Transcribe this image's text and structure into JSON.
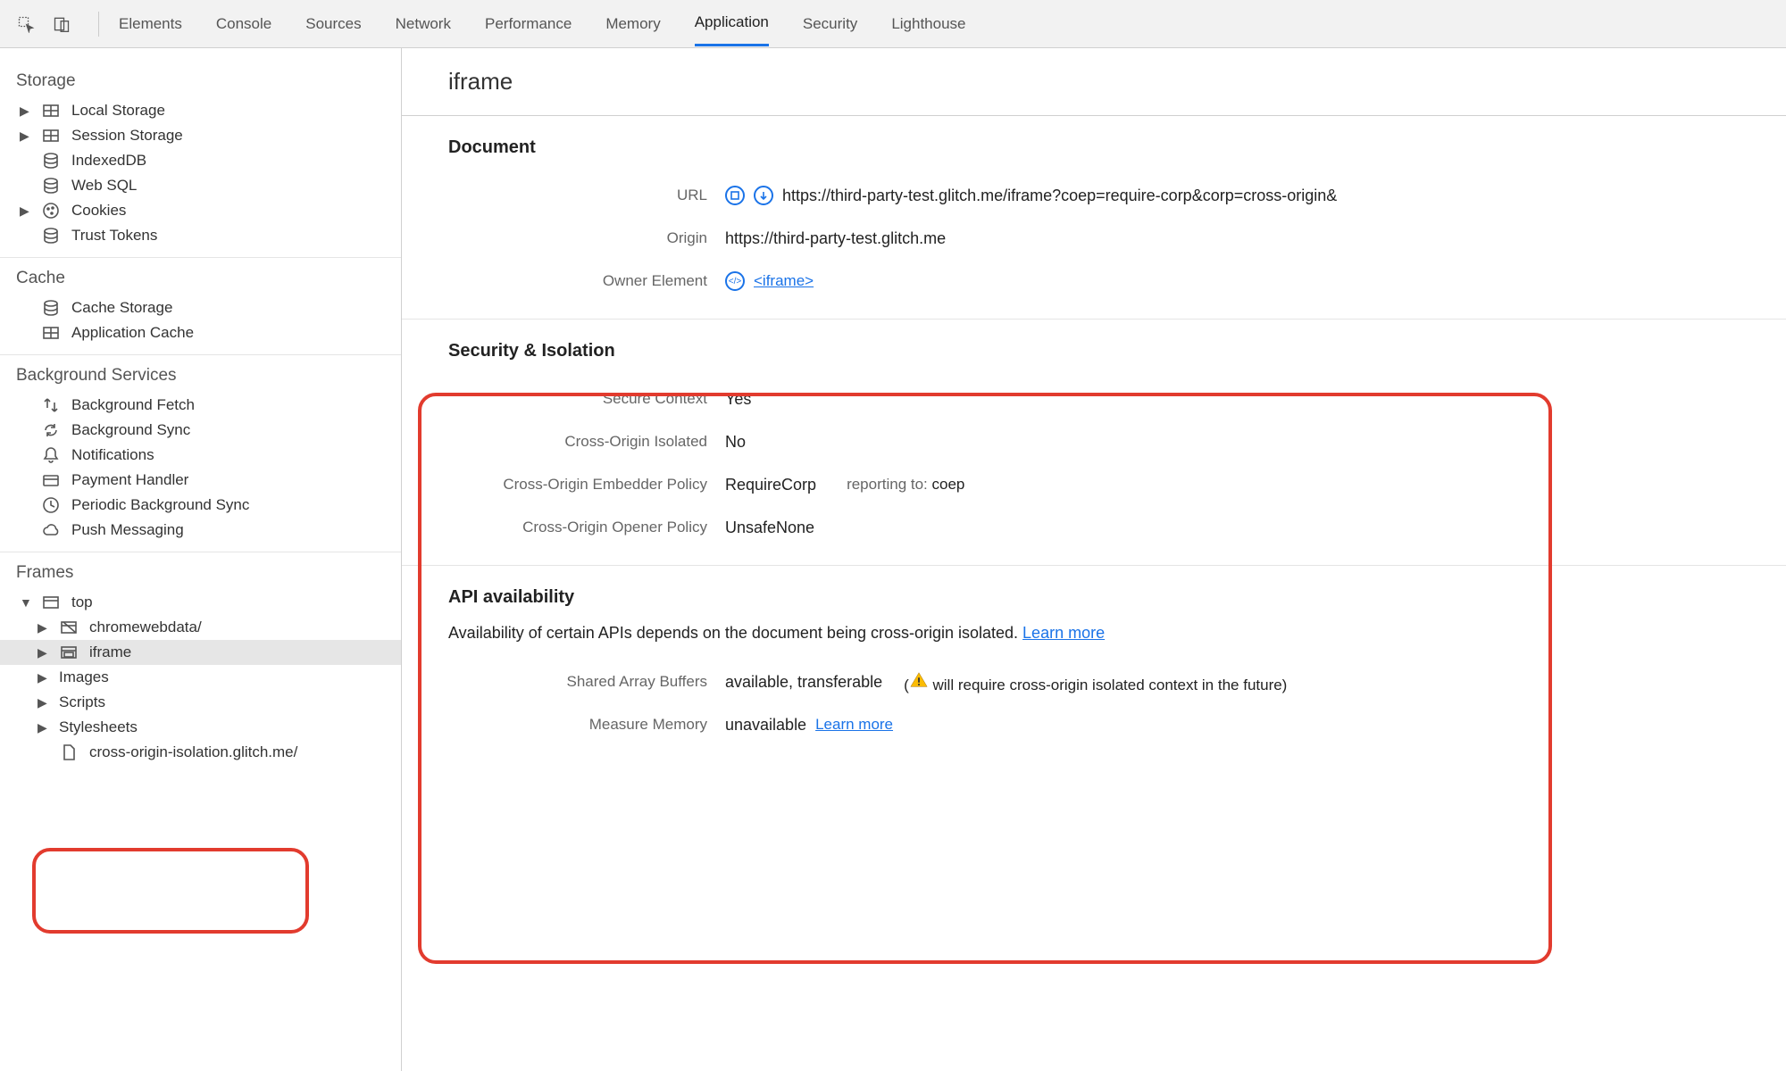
{
  "tabs": [
    "Elements",
    "Console",
    "Sources",
    "Network",
    "Performance",
    "Memory",
    "Application",
    "Security",
    "Lighthouse"
  ],
  "active_tab": "Application",
  "sidebar": {
    "storage": {
      "header": "Storage",
      "items": [
        "Local Storage",
        "Session Storage",
        "IndexedDB",
        "Web SQL",
        "Cookies",
        "Trust Tokens"
      ]
    },
    "cache": {
      "header": "Cache",
      "items": [
        "Cache Storage",
        "Application Cache"
      ]
    },
    "bg": {
      "header": "Background Services",
      "items": [
        "Background Fetch",
        "Background Sync",
        "Notifications",
        "Payment Handler",
        "Periodic Background Sync",
        "Push Messaging"
      ]
    },
    "frames": {
      "header": "Frames",
      "top": "top",
      "children": [
        "chromewebdata/",
        "iframe",
        "Images",
        "Scripts",
        "Stylesheets",
        "cross-origin-isolation.glitch.me/"
      ]
    }
  },
  "main": {
    "title": "iframe",
    "document": {
      "heading": "Document",
      "url_label": "URL",
      "url": "https://third-party-test.glitch.me/iframe?coep=require-corp&corp=cross-origin&",
      "origin_label": "Origin",
      "origin": "https://third-party-test.glitch.me",
      "owner_label": "Owner Element",
      "owner_link": "<iframe>"
    },
    "security": {
      "heading": "Security & Isolation",
      "secure_label": "Secure Context",
      "secure_val": "Yes",
      "coi_label": "Cross-Origin Isolated",
      "coi_val": "No",
      "coep_label": "Cross-Origin Embedder Policy",
      "coep_val": "RequireCorp",
      "coep_sub_prefix": "reporting to: ",
      "coep_sub_val": "coep",
      "coop_label": "Cross-Origin Opener Policy",
      "coop_val": "UnsafeNone"
    },
    "api": {
      "heading": "API availability",
      "desc": "Availability of certain APIs depends on the document being cross-origin isolated. ",
      "learn_more": "Learn more",
      "sab_label": "Shared Array Buffers",
      "sab_val": "available, transferable",
      "sab_note_open": "(",
      "sab_note_text": " will require cross-origin isolated context in the future)",
      "mm_label": "Measure Memory",
      "mm_val": "unavailable ",
      "mm_link": "Learn more"
    }
  }
}
